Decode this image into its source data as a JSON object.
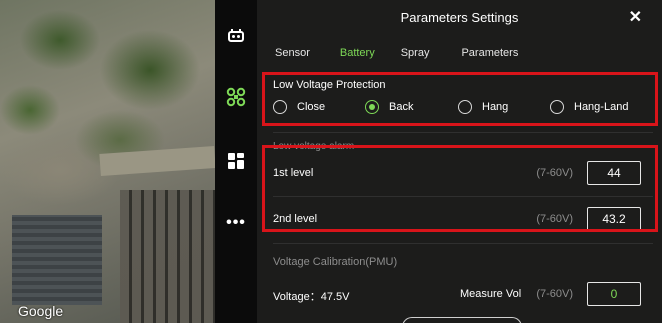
{
  "map": {
    "watermark": "Google"
  },
  "rail": {
    "items": [
      {
        "icon": "drone-controller-icon"
      },
      {
        "icon": "drone-icon",
        "color": "#7ed957"
      },
      {
        "icon": "grid-icon"
      },
      {
        "icon": "more-icon",
        "label": "•••"
      }
    ]
  },
  "panel": {
    "title": "Parameters Settings",
    "close_label": "✕",
    "tabs": [
      {
        "label": "Sensor",
        "active": false
      },
      {
        "label": "Battery",
        "active": true
      },
      {
        "label": "Spray",
        "active": false
      },
      {
        "label": "Parameters",
        "active": false
      }
    ],
    "low_voltage_protection": {
      "label": "Low Voltage Protection",
      "options": [
        {
          "label": "Close",
          "selected": false
        },
        {
          "label": "Back",
          "selected": true
        },
        {
          "label": "Hang",
          "selected": false
        },
        {
          "label": "Hang-Land",
          "selected": false
        }
      ]
    },
    "low_voltage_alarm": {
      "label": "Low voltage alarm",
      "levels": [
        {
          "label": "1st level",
          "range": "(7-60V)",
          "value": "44"
        },
        {
          "label": "2nd level",
          "range": "(7-60V)",
          "value": "43.2"
        }
      ]
    },
    "calibration": {
      "label": "Voltage Calibration(PMU)",
      "voltage_label": "Voltage：47.5V",
      "measure_label": "Measure Vol",
      "range": "(7-60V)",
      "value": "0"
    }
  },
  "colors": {
    "accent": "#7ed957",
    "highlight": "#d8141a",
    "panel_bg": "#1c1c1b"
  }
}
